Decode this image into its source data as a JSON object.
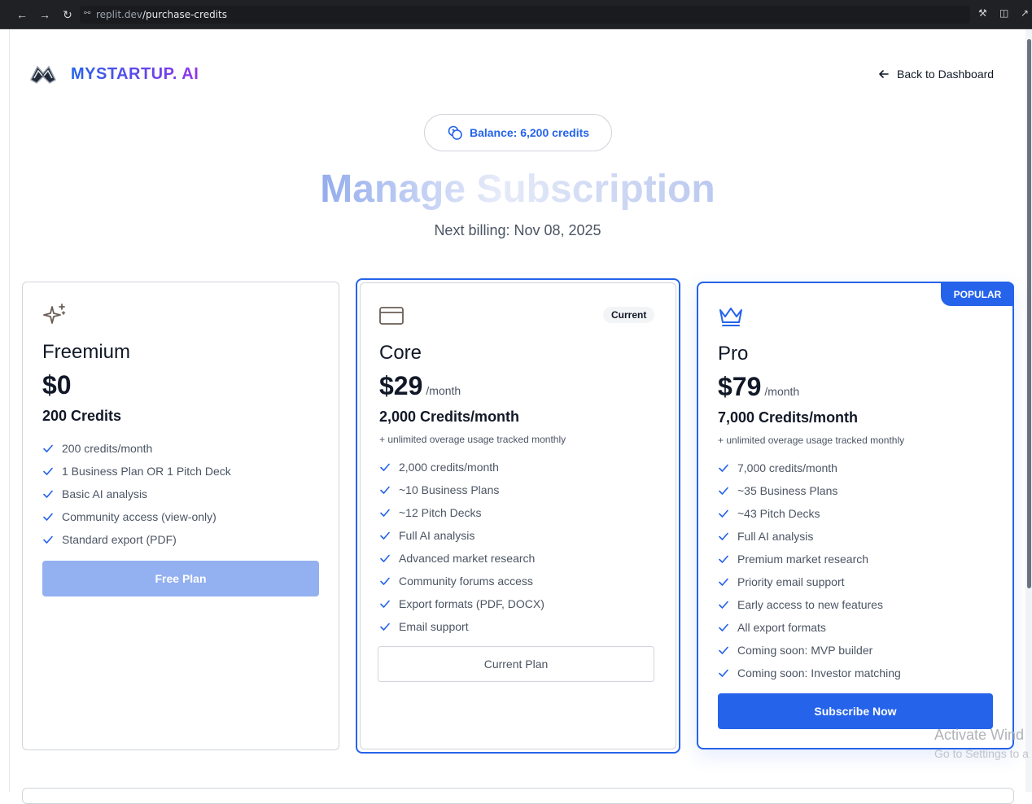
{
  "browser": {
    "url_host": "replit.dev",
    "url_path": "/purchase-credits"
  },
  "header": {
    "brand": "MYSTARTUP. AI",
    "back_label": "Back to Dashboard"
  },
  "balance": {
    "label": "Balance: 6,200 credits"
  },
  "title": "Manage Subscription",
  "next_billing": "Next billing: Nov 08, 2025",
  "plans": [
    {
      "name": "Freemium",
      "price": "$0",
      "period": "",
      "credits": "200 Credits",
      "note": "",
      "features": [
        "200 credits/month",
        "1 Business Plan OR 1 Pitch Deck",
        "Basic AI analysis",
        "Community access (view-only)",
        "Standard export (PDF)"
      ],
      "button": "Free Plan"
    },
    {
      "name": "Core",
      "price": "$29",
      "period": "/month",
      "credits": "2,000 Credits/month",
      "note": "+ unlimited overage usage tracked monthly",
      "badge": "Current",
      "features": [
        "2,000 credits/month",
        "~10 Business Plans",
        "~12 Pitch Decks",
        "Full AI analysis",
        "Advanced market research",
        "Community forums access",
        "Export formats (PDF, DOCX)",
        "Email support"
      ],
      "button": "Current Plan"
    },
    {
      "name": "Pro",
      "price": "$79",
      "period": "/month",
      "credits": "7,000 Credits/month",
      "note": "+ unlimited overage usage tracked monthly",
      "badge": "POPULAR",
      "features": [
        "7,000 credits/month",
        "~35 Business Plans",
        "~43 Pitch Decks",
        "Full AI analysis",
        "Premium market research",
        "Priority email support",
        "Early access to new features",
        "All export formats",
        "Coming soon: MVP builder",
        "Coming soon: Investor matching"
      ],
      "button": "Subscribe Now"
    }
  ],
  "watermark": {
    "title": "Activate Wind",
    "subtitle": "Go to Settings to a"
  },
  "colors": {
    "accent": "#2563eb",
    "brand_gradient_end": "#9333ea",
    "check": "#2563eb"
  },
  "icons": {
    "freemium": "sparkles-icon",
    "core": "credit-card-icon",
    "pro": "crown-icon"
  }
}
